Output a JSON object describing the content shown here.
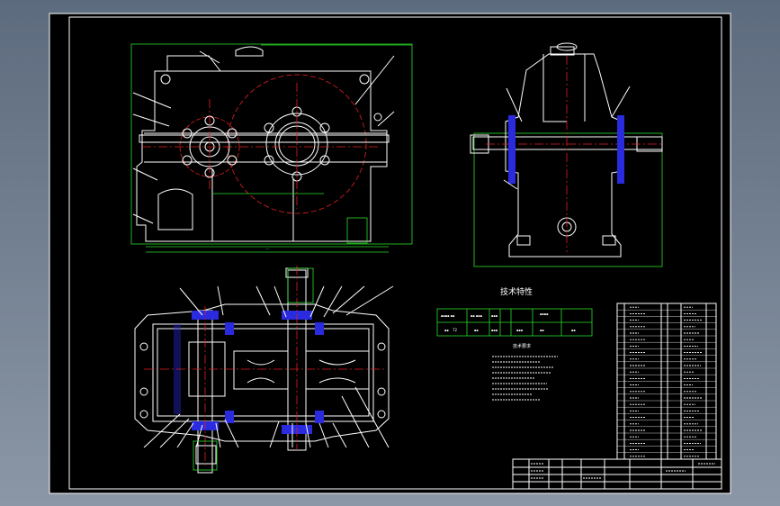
{
  "drawing": {
    "tech_title": "技术特性",
    "req_title": "技术要求",
    "spec_value": "72"
  },
  "colors": {
    "viewport_bg": "#6e7b8d",
    "sheet_bg": "#000000",
    "line": "#ffffff",
    "dimension": "#2bdc2b",
    "center": "#e42020",
    "section": "#2a2adf"
  }
}
